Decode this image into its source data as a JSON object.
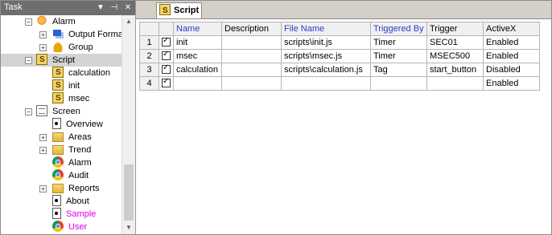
{
  "task_panel": {
    "title": "Task",
    "buttons": {
      "dropdown": "▼",
      "pin": "⊣",
      "close": "✕"
    },
    "tree": [
      {
        "label": "Alarm",
        "icon": "alarm-icon",
        "expander": "−"
      },
      {
        "label": "Output Forma",
        "icon": "output-format-icon",
        "expander": "+"
      },
      {
        "label": "Group",
        "icon": "group-icon",
        "expander": "+"
      },
      {
        "label": "Script",
        "icon": "script-icon",
        "expander": "−",
        "selected": true
      },
      {
        "label": "calculation",
        "icon": "script-icon"
      },
      {
        "label": "init",
        "icon": "script-icon"
      },
      {
        "label": "msec",
        "icon": "script-icon"
      },
      {
        "label": "Screen",
        "icon": "screen-icon",
        "expander": "−"
      },
      {
        "label": "Overview",
        "icon": "document-icon"
      },
      {
        "label": "Areas",
        "icon": "folder-icon",
        "expander": "+"
      },
      {
        "label": "Trend",
        "icon": "folder-icon",
        "expander": "+"
      },
      {
        "label": "Alarm",
        "icon": "chrome-icon"
      },
      {
        "label": "Audit",
        "icon": "chrome-icon"
      },
      {
        "label": "Reports",
        "icon": "folder-icon",
        "expander": "+"
      },
      {
        "label": "About",
        "icon": "document-icon"
      },
      {
        "label": "Sample",
        "icon": "document-icon",
        "color": "#e000e0"
      },
      {
        "label": "User",
        "icon": "chrome-icon",
        "color": "#e000e0"
      }
    ]
  },
  "tab": {
    "label": "Script",
    "icon": "script-icon"
  },
  "grid": {
    "columns": [
      {
        "label": "",
        "blue": false
      },
      {
        "label": "Name",
        "blue": true
      },
      {
        "label": "Description",
        "blue": false
      },
      {
        "label": "File Name",
        "blue": true
      },
      {
        "label": "Triggered By",
        "blue": true
      },
      {
        "label": "Trigger",
        "blue": false
      },
      {
        "label": "ActiveX",
        "blue": false
      }
    ],
    "rows": [
      {
        "num": "1",
        "checked": true,
        "name": "init",
        "description": "",
        "file": "scripts\\init.js",
        "triggered_by": "Timer",
        "trigger": "SEC01",
        "activex": "Enabled"
      },
      {
        "num": "2",
        "checked": true,
        "name": "msec",
        "description": "",
        "file": "scripts\\msec.js",
        "triggered_by": "Timer",
        "trigger": "MSEC500",
        "activex": "Enabled"
      },
      {
        "num": "3",
        "checked": true,
        "name": "calculation",
        "description": "",
        "file": "scripts\\calculation.js",
        "triggered_by": "Tag",
        "trigger": "start_button",
        "activex": "Disabled"
      },
      {
        "num": "4",
        "checked": true,
        "name": "",
        "description": "",
        "file": "",
        "triggered_by": "",
        "trigger": "",
        "activex": "Enabled"
      }
    ]
  }
}
